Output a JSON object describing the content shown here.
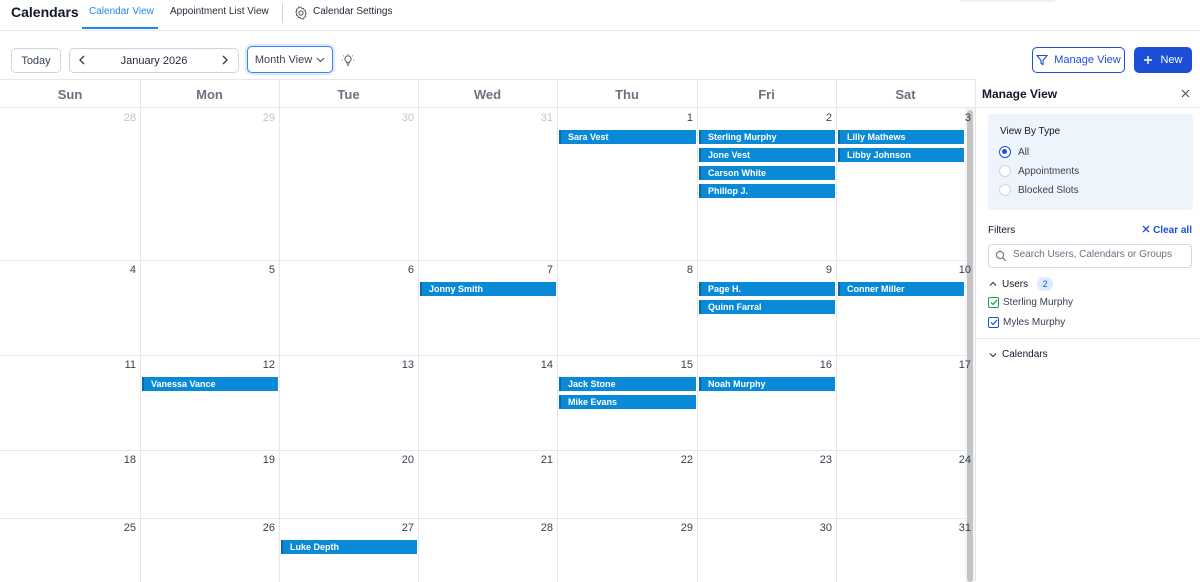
{
  "header": {
    "app_title": "Calendars",
    "tabs": [
      {
        "label": "Calendar View",
        "active": true
      },
      {
        "label": "Appointment List View",
        "active": false
      }
    ],
    "settings_label": "Calendar Settings"
  },
  "toolbar": {
    "today_label": "Today",
    "month_label": "January 2026",
    "view_label": "Month View",
    "manage_view_label": "Manage View",
    "new_label": "New"
  },
  "calendar": {
    "weekdays": [
      "Sun",
      "Mon",
      "Tue",
      "Wed",
      "Thu",
      "Fri",
      "Sat"
    ],
    "weeks": [
      [
        {
          "day": "28",
          "other": true,
          "events": []
        },
        {
          "day": "29",
          "other": true,
          "events": []
        },
        {
          "day": "30",
          "other": true,
          "events": []
        },
        {
          "day": "31",
          "other": true,
          "events": []
        },
        {
          "day": "1",
          "other": false,
          "events": [
            "Sara Vest"
          ]
        },
        {
          "day": "2",
          "other": false,
          "events": [
            "Sterling Murphy",
            "Jone Vest",
            "Carson White",
            "Phillop J."
          ]
        },
        {
          "day": "3",
          "other": false,
          "events": [
            "Lilly Mathews",
            "Libby Johnson"
          ]
        }
      ],
      [
        {
          "day": "4",
          "other": false,
          "events": []
        },
        {
          "day": "5",
          "other": false,
          "events": []
        },
        {
          "day": "6",
          "other": false,
          "events": []
        },
        {
          "day": "7",
          "other": false,
          "events": [
            "Jonny Smith"
          ]
        },
        {
          "day": "8",
          "other": false,
          "events": []
        },
        {
          "day": "9",
          "other": false,
          "events": [
            "Page H.",
            "Quinn Farral"
          ]
        },
        {
          "day": "10",
          "other": false,
          "events": [
            "Conner Miller"
          ]
        }
      ],
      [
        {
          "day": "11",
          "other": false,
          "events": []
        },
        {
          "day": "12",
          "other": false,
          "events": [
            "Vanessa Vance"
          ]
        },
        {
          "day": "13",
          "other": false,
          "events": []
        },
        {
          "day": "14",
          "other": false,
          "events": []
        },
        {
          "day": "15",
          "other": false,
          "events": [
            "Jack Stone",
            "Mike Evans"
          ]
        },
        {
          "day": "16",
          "other": false,
          "events": [
            "Noah Murphy"
          ]
        },
        {
          "day": "17",
          "other": false,
          "events": []
        }
      ],
      [
        {
          "day": "18",
          "other": false,
          "events": []
        },
        {
          "day": "19",
          "other": false,
          "events": []
        },
        {
          "day": "20",
          "other": false,
          "events": []
        },
        {
          "day": "21",
          "other": false,
          "events": []
        },
        {
          "day": "22",
          "other": false,
          "events": []
        },
        {
          "day": "23",
          "other": false,
          "events": []
        },
        {
          "day": "24",
          "other": false,
          "events": []
        }
      ],
      [
        {
          "day": "25",
          "other": false,
          "events": []
        },
        {
          "day": "26",
          "other": false,
          "events": []
        },
        {
          "day": "27",
          "other": false,
          "events": [
            "Luke Depth"
          ]
        },
        {
          "day": "28",
          "other": false,
          "events": []
        },
        {
          "day": "29",
          "other": false,
          "events": []
        },
        {
          "day": "30",
          "other": false,
          "events": []
        },
        {
          "day": "31",
          "other": false,
          "events": []
        }
      ]
    ],
    "event_color": "#0a8ad6"
  },
  "manage_view": {
    "title": "Manage View",
    "view_by_type_label": "View By Type",
    "view_types": [
      {
        "label": "All",
        "selected": true
      },
      {
        "label": "Appointments",
        "selected": false
      },
      {
        "label": "Blocked Slots",
        "selected": false
      }
    ],
    "filters_label": "Filters",
    "clear_all_label": "Clear all",
    "search_placeholder": "Search Users, Calendars or Groups",
    "users_label": "Users",
    "users_count": "2",
    "users": [
      {
        "name": "Sterling Murphy",
        "checked": true,
        "color": "#16a34a"
      },
      {
        "name": "Myles Murphy",
        "checked": true,
        "color": "#1d4ed8"
      }
    ],
    "calendars_label": "Calendars"
  },
  "colors": {
    "accent": "#1d4ed8",
    "tab_active": "#1e88e5"
  }
}
